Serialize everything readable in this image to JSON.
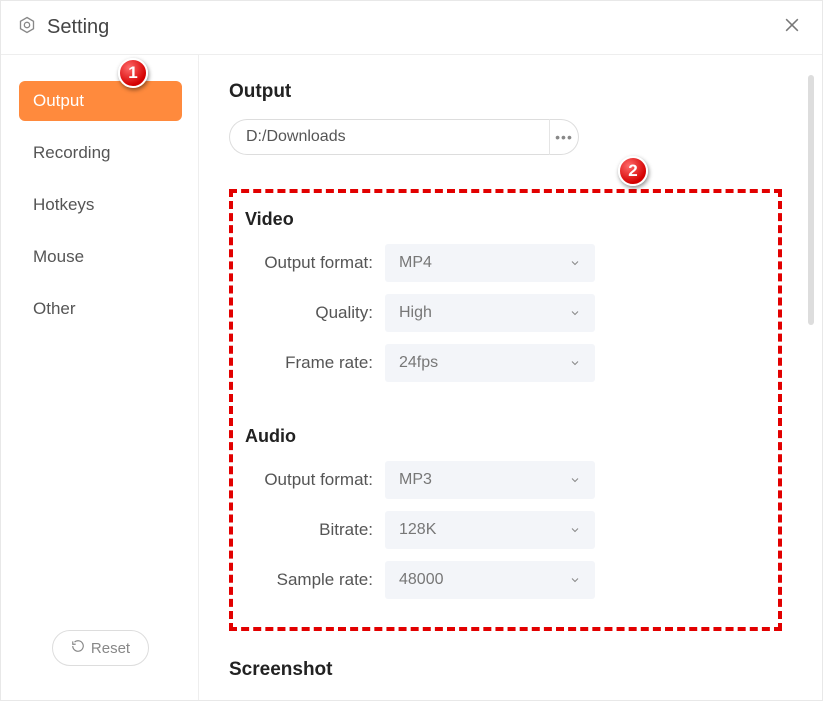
{
  "header": {
    "title": "Setting"
  },
  "sidebar": {
    "items": [
      {
        "label": "Output",
        "active": true
      },
      {
        "label": "Recording",
        "active": false
      },
      {
        "label": "Hotkeys",
        "active": false
      },
      {
        "label": "Mouse",
        "active": false
      },
      {
        "label": "Other",
        "active": false
      }
    ],
    "reset_label": "Reset"
  },
  "main": {
    "output": {
      "title": "Output",
      "path": "D:/Downloads",
      "browse_glyph": "•••"
    },
    "video": {
      "title": "Video",
      "fields": {
        "output_format": {
          "label": "Output format:",
          "value": "MP4"
        },
        "quality": {
          "label": "Quality:",
          "value": "High"
        },
        "frame_rate": {
          "label": "Frame rate:",
          "value": "24fps"
        }
      }
    },
    "audio": {
      "title": "Audio",
      "fields": {
        "output_format": {
          "label": "Output format:",
          "value": "MP3"
        },
        "bitrate": {
          "label": "Bitrate:",
          "value": "128K"
        },
        "sample_rate": {
          "label": "Sample rate:",
          "value": "48000"
        }
      }
    },
    "screenshot": {
      "title": "Screenshot"
    }
  },
  "callouts": {
    "c1": "1",
    "c2": "2"
  },
  "colors": {
    "accent": "#ff8a3d",
    "highlight": "#e20000"
  }
}
